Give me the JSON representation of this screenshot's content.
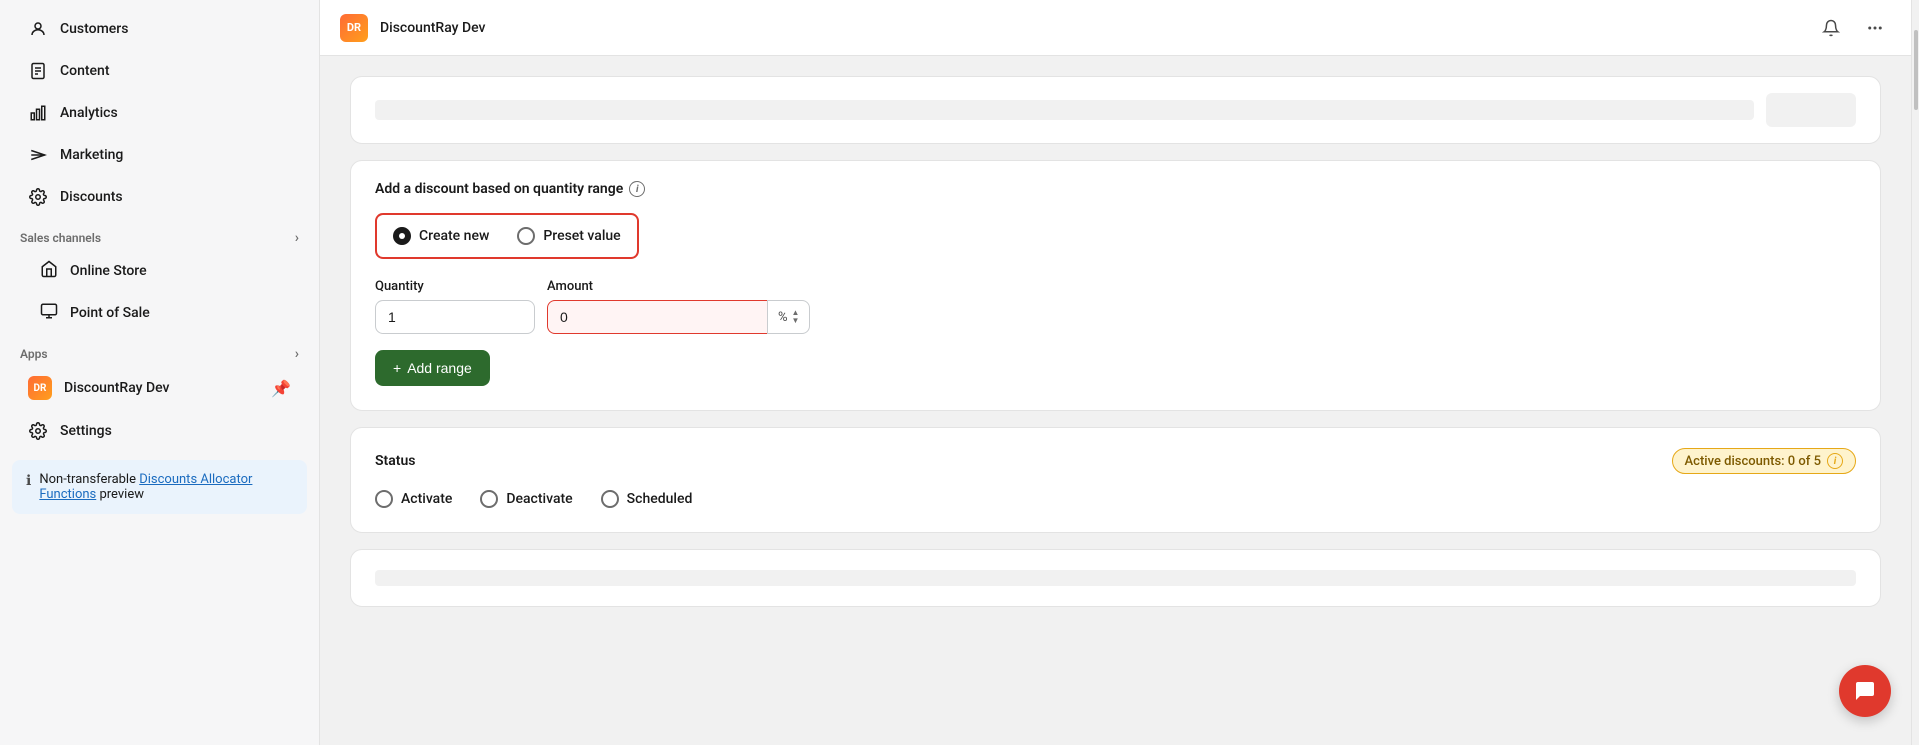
{
  "sidebar": {
    "items": [
      {
        "id": "customers",
        "label": "Customers",
        "icon": "person"
      },
      {
        "id": "content",
        "label": "Content",
        "icon": "document"
      },
      {
        "id": "analytics",
        "label": "Analytics",
        "icon": "bar-chart"
      },
      {
        "id": "marketing",
        "label": "Marketing",
        "icon": "megaphone"
      },
      {
        "id": "discounts",
        "label": "Discounts",
        "icon": "gear"
      }
    ],
    "sales_channels_label": "Sales channels",
    "sales_channels_items": [
      {
        "id": "online-store",
        "label": "Online Store",
        "icon": "store"
      },
      {
        "id": "pos",
        "label": "Point of Sale",
        "icon": "pos"
      }
    ],
    "apps_label": "Apps",
    "apps_items": [
      {
        "id": "discountray-dev",
        "label": "DiscountRay Dev",
        "icon": "app"
      }
    ],
    "settings_label": "Settings",
    "info_box_text_before": "Non-transferable ",
    "info_box_link": "Discounts Allocator Functions",
    "info_box_text_after": " preview"
  },
  "topbar": {
    "logo_text": "DR",
    "title": "DiscountRay Dev",
    "bell_icon": "bell",
    "more_icon": "ellipsis"
  },
  "main": {
    "quantity_range_card": {
      "title": "Add a discount based on quantity range",
      "info_icon_label": "i",
      "radio_options": [
        {
          "id": "create-new",
          "label": "Create new",
          "checked": true
        },
        {
          "id": "preset-value",
          "label": "Preset value",
          "checked": false
        }
      ],
      "quantity_label": "Quantity",
      "quantity_value": "1",
      "amount_label": "Amount",
      "amount_value": "0",
      "amount_unit": "%",
      "add_range_btn": "+ Add range"
    },
    "status_card": {
      "title": "Status",
      "active_badge": "Active discounts: 0 of 5",
      "radio_options": [
        {
          "id": "activate",
          "label": "Activate",
          "checked": false
        },
        {
          "id": "deactivate",
          "label": "Deactivate",
          "checked": false
        },
        {
          "id": "scheduled",
          "label": "Scheduled",
          "checked": false
        }
      ]
    }
  },
  "chat": {
    "icon": "chat"
  }
}
